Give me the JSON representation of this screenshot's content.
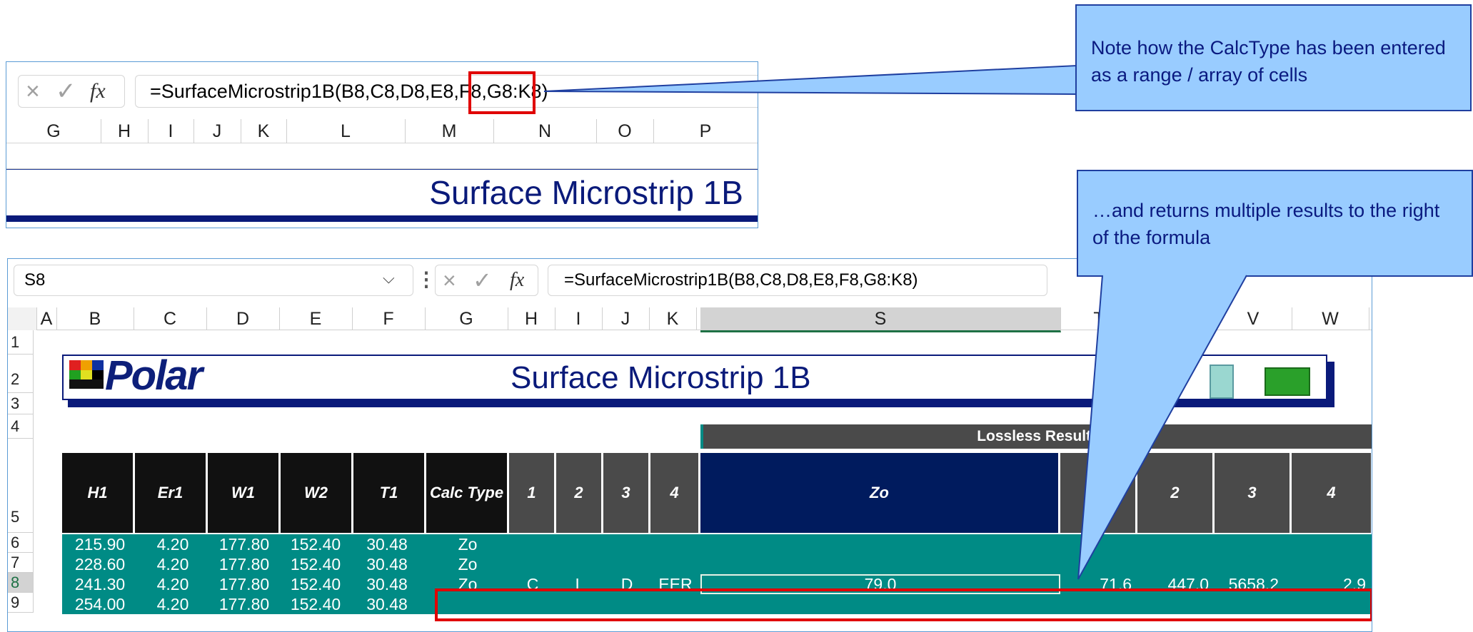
{
  "top": {
    "fx_cancel": "×",
    "fx_enter": "✓",
    "fx_label": "fx",
    "formula": "=SurfaceMicrostrip1B(B8,C8,D8,E8,F8,G8:K8)",
    "columns": [
      "G",
      "H",
      "I",
      "J",
      "K",
      "L",
      "M",
      "N",
      "O",
      "P"
    ],
    "title": "Surface Microstrip 1B"
  },
  "callouts": {
    "note1": "Note how the CalcType has been entered as a range / array of cells",
    "note2": "…and returns multiple results to the right of the formula"
  },
  "bottom": {
    "name_box": "S8",
    "fx_cancel": "×",
    "fx_enter": "✓",
    "fx_label": "fx",
    "formula": "=SurfaceMicrostrip1B(B8,C8,D8,E8,F8,G8:K8)",
    "columns": [
      "A",
      "B",
      "C",
      "D",
      "E",
      "F",
      "G",
      "H",
      "I",
      "J",
      "K",
      "S",
      "T",
      "U",
      "V",
      "W"
    ],
    "rows": [
      "1",
      "2",
      "3",
      "4",
      "5",
      "6",
      "7",
      "8",
      "9"
    ],
    "logo": "Polar",
    "title": "Surface Microstrip 1B",
    "section_header": "Lossless Results",
    "headers": [
      "H1",
      "Er1",
      "W1",
      "W2",
      "T1",
      "Calc Type",
      "1",
      "2",
      "3",
      "4",
      "Zo",
      "1",
      "2",
      "3",
      "4"
    ],
    "data": [
      [
        "215.90",
        "4.20",
        "177.80",
        "152.40",
        "30.48",
        "Zo"
      ],
      [
        "228.60",
        "4.20",
        "177.80",
        "152.40",
        "30.48",
        "Zo"
      ],
      [
        "241.30",
        "4.20",
        "177.80",
        "152.40",
        "30.48",
        "Zo"
      ],
      [
        "254.00",
        "4.20",
        "177.80",
        "152.40",
        "30.48",
        ""
      ]
    ],
    "row8_extra": [
      "C",
      "L",
      "D",
      "EER",
      "79.0",
      "71.6",
      "447.0",
      "5658.2",
      "2.9"
    ]
  },
  "colors": {
    "teal": "#008b85",
    "navy": "#0a1a7a",
    "highlight": "#e00000",
    "callout": "#99ccff"
  }
}
